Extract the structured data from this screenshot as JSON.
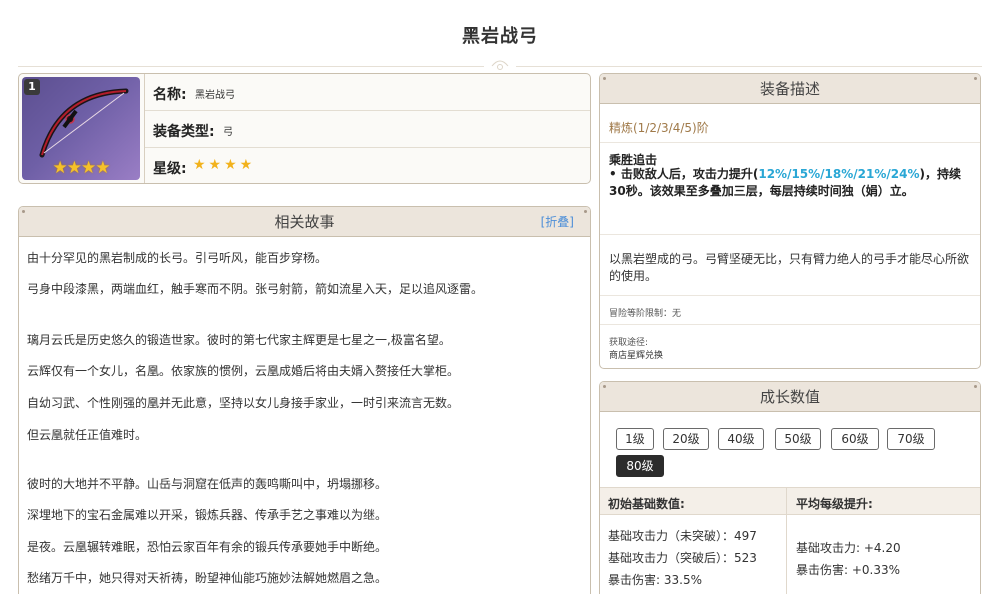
{
  "page": {
    "title": "黑岩战弓"
  },
  "info": {
    "rank_badge": "1",
    "stars_icon": "★★★★",
    "name_label": "名称:",
    "name_value": "黑岩战弓",
    "type_label": "装备类型:",
    "type_value": "弓",
    "star_label": "星级:",
    "star_value": "★★★★",
    "star_count": 4
  },
  "story": {
    "title": "相关故事",
    "fold_label": "[折叠]",
    "lines": [
      "由十分罕见的黑岩制成的长弓。引弓听风，能百步穿杨。",
      "弓身中段漆黑，两端血红，触手寒而不阴。张弓射箭，箭如流星入天，足以追风逐雷。",
      "",
      "璃月云氏是历史悠久的锻造世家。彼时的第七代家主辉更是七星之一,极富名望。",
      "云辉仅有一个女儿，名凰。依家族的惯例，云凰成婚后将由夫婿入赘接任大掌柜。",
      "自幼习武、个性刚强的凰并无此意，坚持以女儿身接手家业，一时引来流言无数。",
      "但云凰就任正值难时。",
      "",
      "彼时的大地并不平静。山岳与洞窟在低声的轰鸣嘶叫中，坍塌挪移。",
      "深埋地下的宝石金属难以开采，锻炼兵器、传承手艺之事难以为继。",
      "是夜。云凰辗转难眠，恐怕云家百年有余的锻兵传承要她手中断绝。",
      "愁绪万千中，她只得对天祈祷，盼望神仙能巧施妙法解她燃眉之急。"
    ]
  },
  "description": {
    "title": "装备描述",
    "refine": "精炼(1/2/3/4/5)阶",
    "passive_name": "乘胜追击",
    "passive_prefix": "• 击败敌人后，攻击力提升(",
    "passive_highlight": "12%/15%/18%/21%/24%",
    "passive_suffix": ")，持续30秒。该效果至多叠加三层，每层持续时间独（娟）立。",
    "flavor": "以黑岩塑成的弓。弓臂坚硬无比，只有臂力绝人的弓手才能尽心所欲的使用。",
    "limit": "冒险等阶限制：无",
    "source_label": "获取途径:",
    "source_value": "商店星辉兑换"
  },
  "growth": {
    "title": "成长数值",
    "levels": [
      "1级",
      "20级",
      "40级",
      "50级",
      "60级",
      "70级",
      "80级"
    ],
    "active_level": "80级",
    "base_header": "初始基础数值:",
    "avg_header": "平均每级提升:",
    "base_stats": [
      "基础攻击力（未突破）：497",
      "基础攻击力（突破后）：523",
      "暴击伤害: 33.5%"
    ],
    "avg_stats": [
      "基础攻击力: +4.20",
      "暴击伤害: +0.33%"
    ]
  },
  "colors": {
    "highlight": "#2aa7d5",
    "refine": "#a07a4a",
    "link": "#4d8fd8",
    "star": "#f2b21c",
    "header_bg": "#ece5dc"
  }
}
